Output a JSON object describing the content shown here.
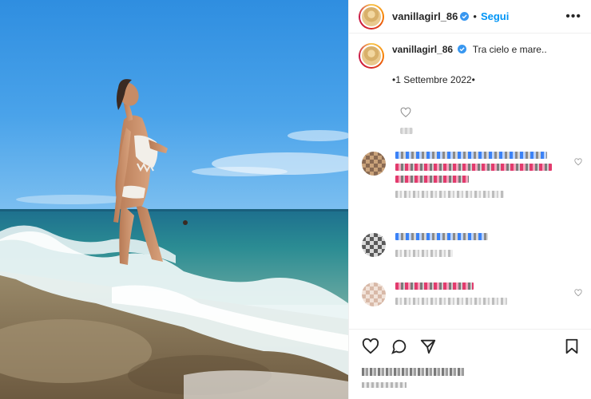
{
  "header": {
    "username": "vanillagirl_86",
    "separator": "•",
    "follow_label": "Segui",
    "more_label": "•••",
    "verified_icon": "verified-badge-icon"
  },
  "caption": {
    "username": "vanillagirl_86",
    "text": "Tra cielo e mare..",
    "date": "•1 Settembre 2022•"
  },
  "icons": {
    "like": "heart-icon",
    "comment": "comment-icon",
    "share": "share-icon",
    "save": "bookmark-icon",
    "more": "more-options-icon"
  },
  "colors": {
    "follow": "#0095f6",
    "verified": "#3897f0",
    "text": "#262626",
    "divider": "#efefef"
  }
}
